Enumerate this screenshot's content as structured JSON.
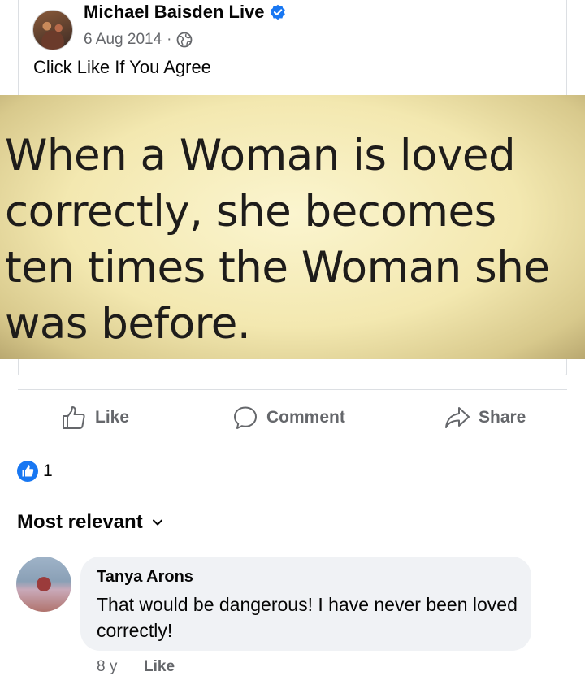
{
  "post": {
    "author": "Michael Baisden Live",
    "date": "6 Aug 2014",
    "separator": "·",
    "caption": "Click Like If You Agree",
    "image_text": "When a Woman is loved\ncorrectly, she becomes\nten times the Woman she\nwas before."
  },
  "actions": {
    "like": "Like",
    "comment": "Comment",
    "share": "Share"
  },
  "reactions": {
    "count": "1"
  },
  "comments_section": {
    "sort_label": "Most relevant",
    "comments": [
      {
        "author": "Tanya Arons",
        "text": "That would be dangerous!  I have never been loved correctly!",
        "time": "8 y",
        "like_label": "Like"
      }
    ]
  },
  "colors": {
    "accent": "#1877f2",
    "secondary_text": "#65676b",
    "bubble": "#f0f2f5"
  },
  "icons": [
    "verified-badge-icon",
    "globe-icon",
    "thumbs-up-icon",
    "comment-icon",
    "share-icon",
    "like-reaction-icon",
    "chevron-down-icon"
  ]
}
